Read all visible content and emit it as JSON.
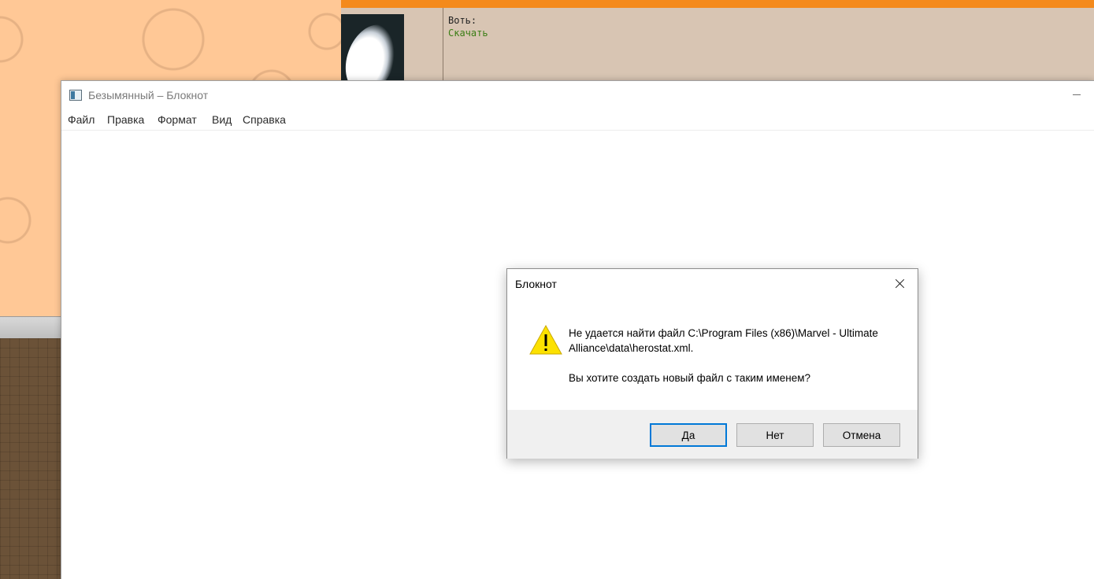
{
  "background_page": {
    "post_label": "Воть:",
    "post_link": "Скачать"
  },
  "notepad": {
    "title": "Безымянный – Блокнот",
    "menu": [
      "Файл",
      "Правка",
      "Формат",
      "Вид",
      "Справка"
    ],
    "app_icon": "notepad-icon"
  },
  "dialog": {
    "title": "Блокнот",
    "icon": "warning-icon",
    "message_line1": "Не удается найти файл C:\\Program Files (x86)\\Marvel - Ultimate",
    "message_line2": "Alliance\\data\\herostat.xml.",
    "question": "Вы хотите создать новый файл с таким именем?",
    "buttons": {
      "yes": "Да",
      "no": "Нет",
      "cancel": "Отмена"
    },
    "default_button": "yes"
  },
  "colors": {
    "orange_bar": "#f48a1c",
    "link_green": "#3a7d14",
    "default_button_border": "#0078d7",
    "warning_yellow": "#fce100"
  }
}
